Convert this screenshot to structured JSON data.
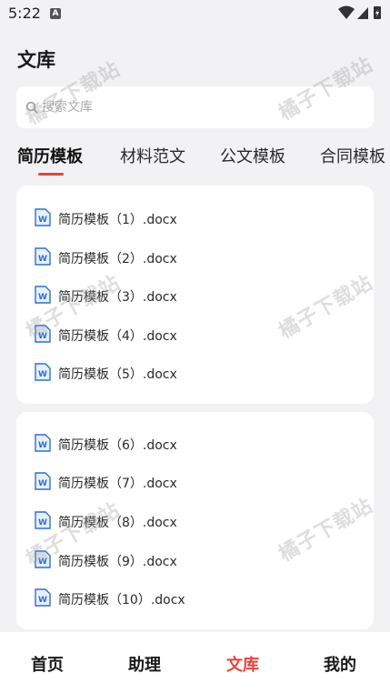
{
  "status_bar": {
    "time": "5:22",
    "notification_icon": "A",
    "icons": [
      "wifi-icon",
      "signal-icon",
      "battery-icon"
    ]
  },
  "header": {
    "title": "文库"
  },
  "search": {
    "placeholder": "搜索文库",
    "value": ""
  },
  "tabs": [
    {
      "label": "简历模板",
      "active": true
    },
    {
      "label": "材料范文",
      "active": false
    },
    {
      "label": "公文模板",
      "active": false
    },
    {
      "label": "合同模板",
      "active": false
    }
  ],
  "files_group_1": [
    {
      "name": "简历模板（1）.docx"
    },
    {
      "name": "简历模板（2）.docx"
    },
    {
      "name": "简历模板（3）.docx"
    },
    {
      "name": "简历模板（4）.docx"
    },
    {
      "name": "简历模板（5）.docx"
    }
  ],
  "files_group_2": [
    {
      "name": "简历模板（6）.docx"
    },
    {
      "name": "简历模板（7）.docx"
    },
    {
      "name": "简历模板（8）.docx"
    },
    {
      "name": "简历模板（9）.docx"
    },
    {
      "name": "简历模板（10）.docx"
    }
  ],
  "watermark": "橘子下载站",
  "bottom_nav": [
    {
      "label": "首页",
      "active": false
    },
    {
      "label": "助理",
      "active": false
    },
    {
      "label": "文库",
      "active": true
    },
    {
      "label": "我的",
      "active": false
    }
  ],
  "colors": {
    "accent": "#e9433b",
    "background": "#f2f2f4",
    "card": "#ffffff",
    "word_icon": "#2b6fd6"
  }
}
